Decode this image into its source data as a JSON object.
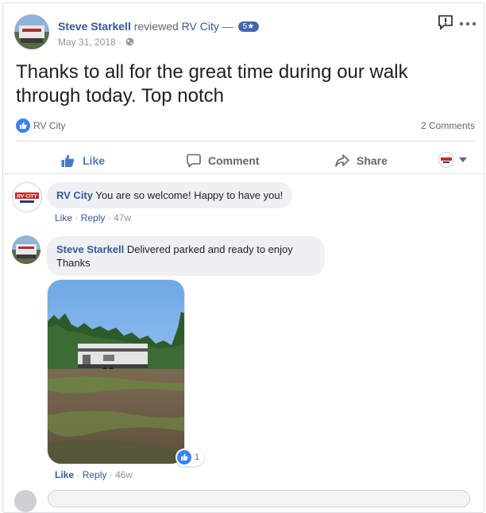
{
  "post": {
    "author": "Steve Starkell",
    "reviewed": "reviewed",
    "page": "RV City",
    "dash": "—",
    "rating": "5★",
    "date": "May 31, 2018 ·",
    "text": "Thanks to all for the great time during our walk through today. Top notch",
    "reaction_name": "RV City",
    "comments_count": "2 Comments"
  },
  "actions": {
    "like": "Like",
    "comment": "Comment",
    "share": "Share"
  },
  "comments": [
    {
      "name": "RV City",
      "text": "You are so welcome! Happy to have you!",
      "like": "Like",
      "reply": "Reply",
      "time": "47w",
      "sep": "·"
    },
    {
      "name": "Steve Starkell",
      "text": "Delivered parked and ready to enjoy",
      "text2": "Thanks",
      "like": "Like",
      "reply": "Reply",
      "time": "46w",
      "sep": "·",
      "reaction_count": "1"
    }
  ],
  "logo_text": "RV CITY",
  "colors": {
    "link": "#365899",
    "facebook_blue": "#4267b2",
    "muted": "#90949c"
  }
}
